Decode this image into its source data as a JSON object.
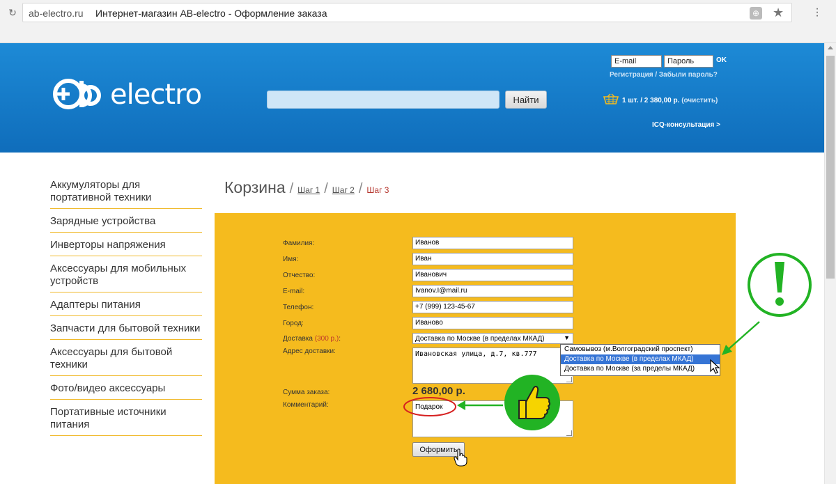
{
  "browser": {
    "domain": "ab-electro.ru",
    "title": "Интернет-магазин AB-electro - Оформление заказа",
    "reload_icon": "reload-icon",
    "star_icon": "bookmark-star-icon",
    "menu_icon": "vertical-dots-menu-icon"
  },
  "header": {
    "logo_text": "electro",
    "search_placeholder": "",
    "search_button": "Найти",
    "email_placeholder": "E-mail",
    "password_placeholder": "Пароль",
    "ok_label": "OK",
    "register_link": "Регистрация",
    "auth_separator": " / ",
    "forgot_link": "Забыли пароль?",
    "cart_summary": "1 шт. / 2 380,00 р.",
    "cart_clear": "(очистить)",
    "icq_link": "ICQ-консультация >",
    "colors": {
      "band_top": "#1d8ad6",
      "band_bottom": "#0f6dbb"
    }
  },
  "sidebar": {
    "items": [
      "Аккумуляторы для портативной техники",
      "Зарядные устройства",
      "Инверторы напряжения",
      "Аксессуары для мобильных устройств",
      "Адаптеры питания",
      "Запчасти для бытовой техники",
      "Аксессуары для бытовой техники",
      "Фото/видео аксессуары",
      "Портативные источники питания"
    ]
  },
  "breadcrumb": {
    "title": "Корзина",
    "sep": "/",
    "step1": "Шаг 1",
    "step2": "Шаг 2",
    "step3": "Шаг 3"
  },
  "form": {
    "labels": {
      "last_name": "Фамилия:",
      "first_name": "Имя:",
      "patronymic": "Отчество:",
      "email": "E-mail:",
      "phone": "Телефон:",
      "city": "Город:",
      "delivery": "Доставка",
      "delivery_price": "(300 р.)",
      "delivery_colon": ":",
      "address": "Адрес доставки:",
      "total": "Сумма заказа:",
      "comment": "Комментарий:"
    },
    "values": {
      "last_name": "Иванов",
      "first_name": "Иван",
      "patronymic": "Иванович",
      "email": "Ivanov.I@mail.ru",
      "phone": "+7 (999) 123-45-67",
      "city": "Иваново",
      "delivery_selected": "Доставка по Москве (в пределах МКАД)",
      "address": "Ивановская улица, д.7, кв.777",
      "total": "2 680,00 р.",
      "comment": "Подарок"
    },
    "delivery_options": [
      "Самовывоз (м.Волгоградский проспект)",
      "Доставка по Москве (в пределах МКАД)",
      "Доставка по Москве (за пределы МКАД)"
    ],
    "selected_option_index": 1,
    "submit_label": "Оформить",
    "panel_color": "#f5bb1e"
  },
  "annotations": {
    "exclaim_icon": "green-exclamation-circle",
    "thumb_icon": "thumbs-up-badge",
    "accent_green": "#22b324",
    "highlight_red": "#d62020"
  }
}
